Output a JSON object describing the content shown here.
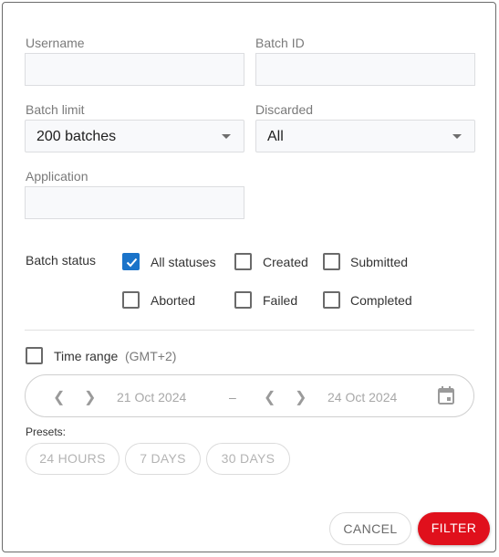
{
  "form": {
    "username": {
      "label": "Username",
      "value": ""
    },
    "batch_id": {
      "label": "Batch ID",
      "value": ""
    },
    "batch_limit": {
      "label": "Batch limit",
      "value": "200 batches"
    },
    "discarded": {
      "label": "Discarded",
      "value": "All"
    },
    "application": {
      "label": "Application",
      "value": ""
    },
    "batch_status": {
      "label": "Batch status",
      "options": [
        {
          "label": "All statuses",
          "checked": true
        },
        {
          "label": "Created",
          "checked": false
        },
        {
          "label": "Submitted",
          "checked": false
        },
        {
          "label": "Aborted",
          "checked": false
        },
        {
          "label": "Failed",
          "checked": false
        },
        {
          "label": "Completed",
          "checked": false
        }
      ]
    },
    "time_range": {
      "label": "Time range",
      "timezone": "(GMT+2)",
      "checked": false,
      "start_date": "21 Oct 2024",
      "separator": "–",
      "end_date": "24 Oct 2024",
      "prev_icon": "chevron-left-icon",
      "next_icon": "chevron-right-icon",
      "calendar_icon": "calendar-icon"
    },
    "presets": {
      "label": "Presets:",
      "items": [
        "24 HOURS",
        "7 DAYS",
        "30 DAYS"
      ]
    }
  },
  "actions": {
    "cancel": "CANCEL",
    "filter": "FILTER",
    "filter_color": "#e0101c"
  }
}
